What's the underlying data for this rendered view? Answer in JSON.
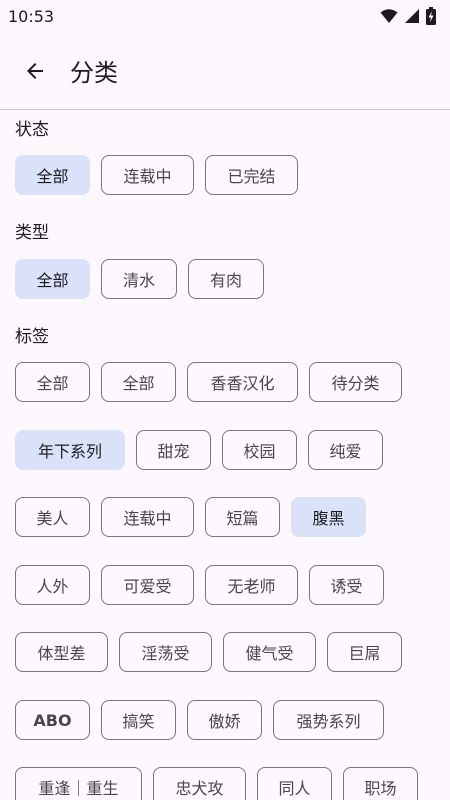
{
  "status_bar": {
    "time": "10:53"
  },
  "app_bar": {
    "title": "分类"
  },
  "filters": {
    "status": {
      "title": "状态",
      "options": [
        "全部",
        "连载中",
        "已完结"
      ],
      "selected": "全部"
    },
    "type": {
      "title": "类型",
      "options": [
        "全部",
        "清水",
        "有肉"
      ],
      "selected": "全部"
    },
    "tags": {
      "title": "标签",
      "rows": [
        [
          "全部",
          "全部",
          "香香汉化",
          "待分类"
        ],
        [
          "年下系列",
          "甜宠",
          "校园",
          "纯爱"
        ],
        [
          "美人",
          "连载中",
          "短篇",
          "腹黑"
        ],
        [
          "人外",
          "可爱受",
          "无老师",
          "诱受"
        ],
        [
          "体型差",
          "淫荡受",
          "健气受",
          "巨屌"
        ],
        [
          "ABO",
          "搞笑",
          "傲娇",
          "强势系列"
        ],
        [
          "重逢｜重生",
          "忠犬攻",
          "同人",
          "职场"
        ]
      ],
      "selected": [
        "年下系列",
        "腹黑"
      ]
    }
  },
  "colors": {
    "background": "#fdf8fd",
    "chip_selected_bg": "#dae2fa",
    "chip_border": "#79747e"
  }
}
